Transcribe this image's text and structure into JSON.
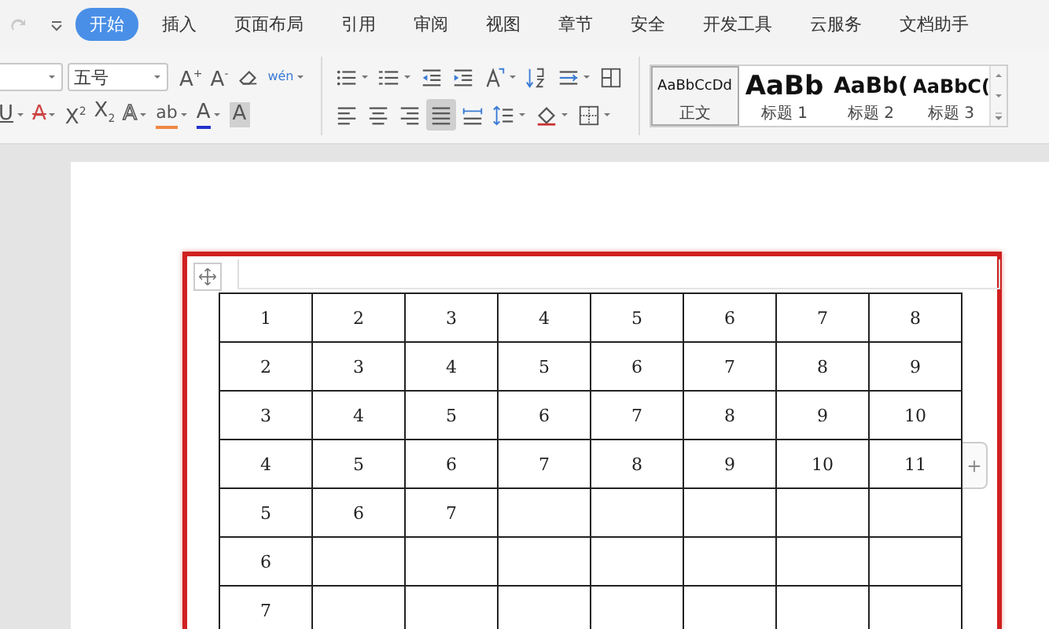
{
  "menu": {
    "tabs": [
      {
        "label": "开始",
        "selected": true
      },
      {
        "label": "插入",
        "selected": false
      },
      {
        "label": "页面布局",
        "selected": false
      },
      {
        "label": "引用",
        "selected": false
      },
      {
        "label": "审阅",
        "selected": false
      },
      {
        "label": "视图",
        "selected": false
      },
      {
        "label": "章节",
        "selected": false
      },
      {
        "label": "安全",
        "selected": false
      },
      {
        "label": "开发工具",
        "selected": false
      },
      {
        "label": "云服务",
        "selected": false
      },
      {
        "label": "文档助手",
        "selected": false
      }
    ]
  },
  "toolbar": {
    "font_size_field": {
      "value": "五号"
    },
    "row1_font": [
      {
        "kind": "plain",
        "text": "A$^{+}$",
        "dropdown": false
      },
      {
        "kind": "plain",
        "text": "A$^{-}$",
        "dropdown": false
      },
      {
        "kind": "eraser",
        "dropdown": false
      },
      {
        "kind": "pinyin",
        "text": "wén",
        "dropdown": true
      }
    ],
    "row2_font": [
      {
        "kind": "underline",
        "text": "U",
        "dropdown": true
      },
      {
        "kind": "strike",
        "text": "A",
        "dropdown": true
      },
      {
        "kind": "plain",
        "text": "X$^{2}$",
        "dropdown": false
      },
      {
        "kind": "plain",
        "text": "X$_{2}$",
        "dropdown": false
      },
      {
        "kind": "outline",
        "text": "A",
        "dropdown": true
      },
      {
        "kind": "highlight",
        "text": "ab",
        "dropdown": true
      },
      {
        "kind": "fontcolor",
        "text": "A",
        "dropdown": true
      },
      {
        "kind": "shade",
        "text": "A",
        "dropdown": false
      }
    ],
    "row1_para": [
      {
        "kind": "bullets",
        "dropdown": true,
        "selected": false
      },
      {
        "kind": "numbering",
        "dropdown": true,
        "selected": false
      },
      {
        "kind": "outdent",
        "dropdown": false,
        "selected": false
      },
      {
        "kind": "indent",
        "dropdown": false,
        "selected": false
      },
      {
        "kind": "layout",
        "dropdown": true,
        "selected": false
      },
      {
        "kind": "sort",
        "dropdown": false,
        "selected": false
      },
      {
        "kind": "tabs",
        "dropdown": true,
        "selected": false
      },
      {
        "kind": "grid",
        "dropdown": false,
        "selected": false
      }
    ],
    "row2_para": [
      {
        "kind": "align-left",
        "dropdown": false,
        "selected": false
      },
      {
        "kind": "align-center",
        "dropdown": false,
        "selected": false
      },
      {
        "kind": "align-right",
        "dropdown": false,
        "selected": false
      },
      {
        "kind": "justify",
        "dropdown": false,
        "selected": true
      },
      {
        "kind": "distribute",
        "dropdown": false,
        "selected": false
      },
      {
        "kind": "line-spacing",
        "dropdown": true,
        "selected": false
      },
      {
        "kind": "shading",
        "dropdown": true,
        "selected": false
      },
      {
        "kind": "borders",
        "dropdown": true,
        "selected": false
      }
    ],
    "styles": [
      {
        "preview": "AaBbCcDd",
        "label": "正文",
        "kind": "body",
        "selected": true
      },
      {
        "preview": "AaBb",
        "label": "标题 1",
        "kind": "h1",
        "selected": false
      },
      {
        "preview": "AaBb(",
        "label": "标题 2",
        "kind": "h2",
        "selected": false
      },
      {
        "preview": "AaBbC(",
        "label": "标题 3",
        "kind": "h3",
        "selected": false
      }
    ]
  },
  "table": {
    "rows": [
      [
        "1",
        "2",
        "3",
        "4",
        "5",
        "6",
        "7",
        "8"
      ],
      [
        "2",
        "3",
        "4",
        "5",
        "6",
        "7",
        "8",
        "9"
      ],
      [
        "3",
        "4",
        "5",
        "6",
        "7",
        "8",
        "9",
        "10"
      ],
      [
        "4",
        "5",
        "6",
        "7",
        "8",
        "9",
        "10",
        "11"
      ],
      [
        "5",
        "6",
        "7"
      ],
      [
        "6"
      ],
      [
        "7"
      ]
    ]
  }
}
